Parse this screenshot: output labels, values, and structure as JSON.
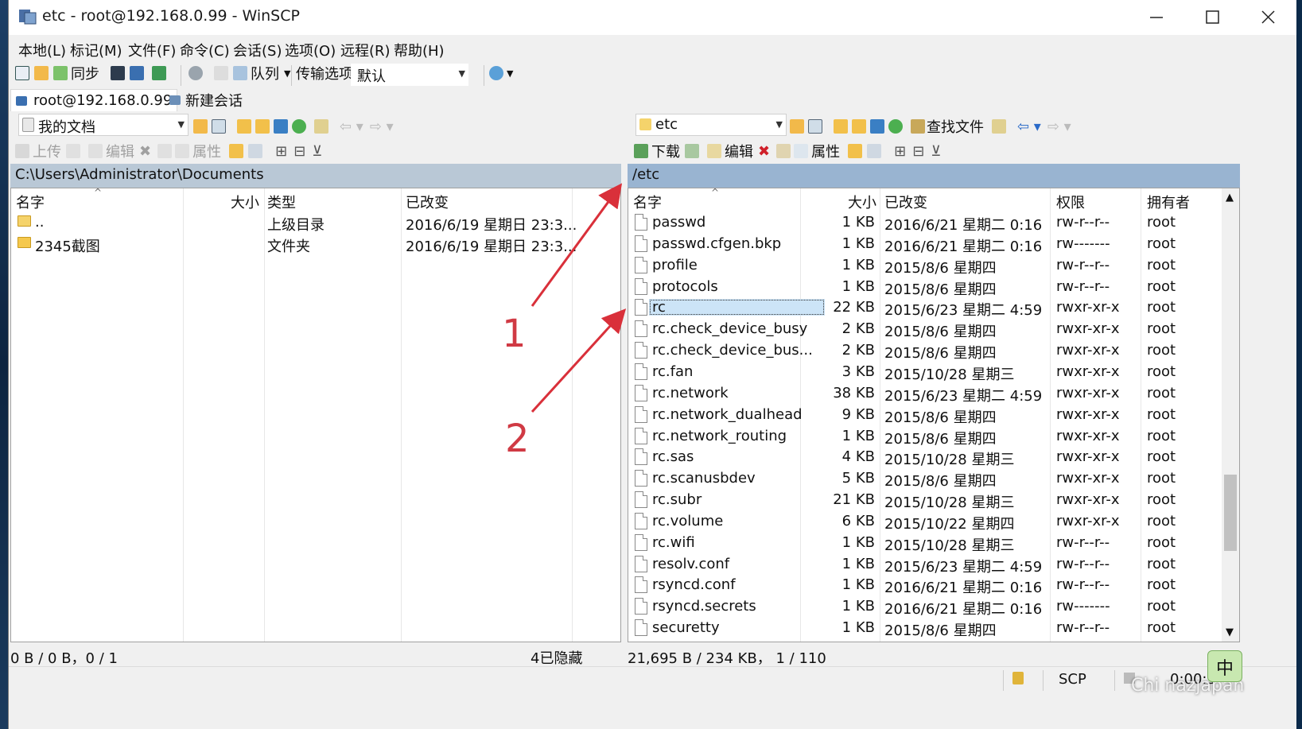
{
  "window": {
    "title": "etc - root@192.168.0.99 - WinSCP"
  },
  "menu": [
    "本地(L)",
    "标记(M)",
    "文件(F)",
    "命令(C)",
    "会话(S)",
    "选项(O)",
    "远程(R)",
    "帮助(H)"
  ],
  "toolbar": {
    "sync_label": "同步",
    "queue_label": "队列",
    "transfer_options_label": "传输选项",
    "transfer_preset": "默认"
  },
  "sessions": {
    "active": "root@192.168.0.99",
    "new_session": "新建会话"
  },
  "local": {
    "location": "我的文档",
    "actions": {
      "upload": "上传",
      "edit": "编辑",
      "properties": "属性"
    },
    "path": "C:\\Users\\Administrator\\Documents",
    "columns": {
      "name": "名字",
      "size": "大小",
      "type": "类型",
      "changed": "已改变"
    },
    "files": [
      {
        "name": "..",
        "type": "上级目录",
        "changed": "2016/6/19 星期日  23:3..."
      },
      {
        "name": "2345截图",
        "type": "文件夹",
        "changed": "2016/6/19 星期日  23:3..."
      }
    ],
    "status": "0 B / 0 B，0 / 1",
    "hidden": "4已隐藏"
  },
  "remote": {
    "location": "etc",
    "find_files": "查找文件",
    "actions": {
      "download": "下载",
      "edit": "编辑",
      "properties": "属性"
    },
    "path": "/etc",
    "columns": {
      "name": "名字",
      "size": "大小",
      "changed": "已改变",
      "rights": "权限",
      "owner": "拥有者"
    },
    "files": [
      {
        "name": "passwd",
        "size": "1 KB",
        "changed": "2016/6/21 星期二 0:16",
        "rights": "rw-r--r--",
        "owner": "root"
      },
      {
        "name": "passwd.cfgen.bkp",
        "size": "1 KB",
        "changed": "2016/6/21 星期二 0:16",
        "rights": "rw-------",
        "owner": "root"
      },
      {
        "name": "profile",
        "size": "1 KB",
        "changed": "2015/8/6 星期四",
        "rights": "rw-r--r--",
        "owner": "root"
      },
      {
        "name": "protocols",
        "size": "1 KB",
        "changed": "2015/8/6 星期四",
        "rights": "rw-r--r--",
        "owner": "root"
      },
      {
        "name": "rc",
        "size": "22 KB",
        "changed": "2015/6/23 星期二 4:59",
        "rights": "rwxr-xr-x",
        "owner": "root"
      },
      {
        "name": "rc.check_device_busy",
        "size": "2 KB",
        "changed": "2015/8/6 星期四",
        "rights": "rwxr-xr-x",
        "owner": "root"
      },
      {
        "name": "rc.check_device_bus...",
        "size": "2 KB",
        "changed": "2015/8/6 星期四",
        "rights": "rwxr-xr-x",
        "owner": "root"
      },
      {
        "name": "rc.fan",
        "size": "3 KB",
        "changed": "2015/10/28 星期三",
        "rights": "rwxr-xr-x",
        "owner": "root"
      },
      {
        "name": "rc.network",
        "size": "38 KB",
        "changed": "2015/6/23 星期二 4:59",
        "rights": "rwxr-xr-x",
        "owner": "root"
      },
      {
        "name": "rc.network_dualhead",
        "size": "9 KB",
        "changed": "2015/8/6 星期四",
        "rights": "rwxr-xr-x",
        "owner": "root"
      },
      {
        "name": "rc.network_routing",
        "size": "1 KB",
        "changed": "2015/8/6 星期四",
        "rights": "rwxr-xr-x",
        "owner": "root"
      },
      {
        "name": "rc.sas",
        "size": "4 KB",
        "changed": "2015/10/28 星期三",
        "rights": "rwxr-xr-x",
        "owner": "root"
      },
      {
        "name": "rc.scanusbdev",
        "size": "5 KB",
        "changed": "2015/8/6 星期四",
        "rights": "rwxr-xr-x",
        "owner": "root"
      },
      {
        "name": "rc.subr",
        "size": "21 KB",
        "changed": "2015/10/28 星期三",
        "rights": "rwxr-xr-x",
        "owner": "root"
      },
      {
        "name": "rc.volume",
        "size": "6 KB",
        "changed": "2015/10/22 星期四",
        "rights": "rwxr-xr-x",
        "owner": "root"
      },
      {
        "name": "rc.wifi",
        "size": "1 KB",
        "changed": "2015/10/28 星期三",
        "rights": "rw-r--r--",
        "owner": "root"
      },
      {
        "name": "resolv.conf",
        "size": "1 KB",
        "changed": "2015/6/23 星期二 4:59",
        "rights": "rw-r--r--",
        "owner": "root"
      },
      {
        "name": "rsyncd.conf",
        "size": "1 KB",
        "changed": "2016/6/21 星期二 0:16",
        "rights": "rw-r--r--",
        "owner": "root"
      },
      {
        "name": "rsyncd.secrets",
        "size": "1 KB",
        "changed": "2016/6/21 星期二 0:16",
        "rights": "rw-------",
        "owner": "root"
      },
      {
        "name": "securetty",
        "size": "1 KB",
        "changed": "2015/8/6 星期四",
        "rights": "rw-r--r--",
        "owner": "root"
      }
    ],
    "status": "21,695 B / 234 KB，  1 / 110"
  },
  "bottom_status": {
    "protocol": "SCP",
    "timer": "0:00:3"
  },
  "annotations": {
    "label1": "1",
    "label2": "2",
    "arrow_color": "#d9303a"
  },
  "watermark": "Chi  nazjapan",
  "ime": "中"
}
